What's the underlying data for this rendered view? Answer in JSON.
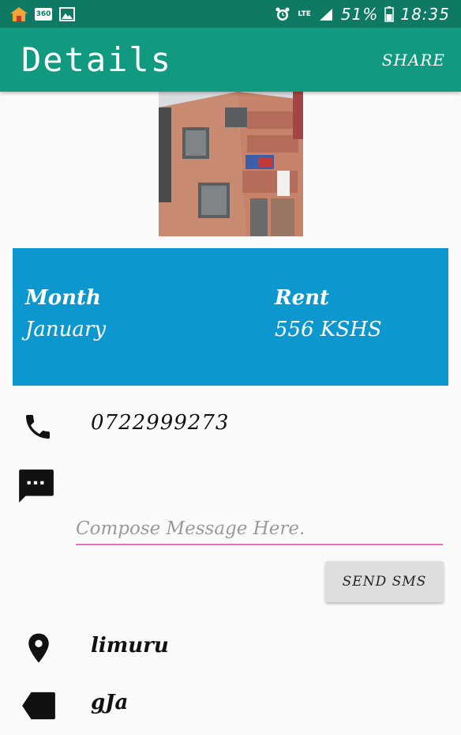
{
  "status_bar": {
    "badge_text": "360",
    "network": "LTE",
    "battery": "51%",
    "time": "18:35"
  },
  "app_bar": {
    "title": "Details",
    "share_label": "SHARE"
  },
  "info": {
    "month_label": "Month",
    "month_value": "January",
    "rent_label": "Rent",
    "rent_value": "556 KSHS"
  },
  "contact": {
    "phone": "0722999273"
  },
  "message": {
    "placeholder": "Compose Message Here.",
    "send_label": "SEND SMS"
  },
  "location": {
    "text": "limuru"
  },
  "label": {
    "text": "gJa"
  },
  "colors": {
    "status_bar": "#0f7a63",
    "app_bar": "#129a80",
    "info_card": "#0c97cf",
    "input_underline": "#e96db3"
  }
}
